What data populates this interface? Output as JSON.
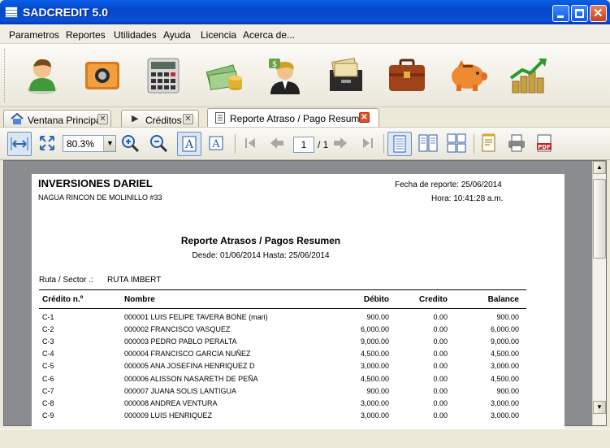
{
  "window": {
    "title": "SADCREDIT 5.0"
  },
  "menu": [
    "Parametros",
    "Reportes",
    "Utilidades",
    "Ayuda",
    "Licencia",
    "Acerca de..."
  ],
  "toolbar_icons": [
    "client-icon",
    "safe-icon",
    "calculator-icon",
    "money-coins-icon",
    "businessman-money-icon",
    "file-cabinet-icon",
    "briefcase-icon",
    "piggy-bank-icon",
    "growth-chart-icon"
  ],
  "tabs": [
    {
      "label": "Ventana Principal",
      "icon": "home-icon"
    },
    {
      "label": "Créditos",
      "icon": "arrow-right-icon"
    },
    {
      "label": "Reporte Atraso / Pago Resumen",
      "icon": "document-icon"
    }
  ],
  "viewer_toolbar": {
    "zoom": "80.3%",
    "page": "1",
    "page_total": "/ 1"
  },
  "report": {
    "company": "INVERSIONES DARIEL",
    "address": "NAGUA RINCON DE MOLINILLO #33",
    "report_date": "Fecha de reporte: 25/06/2014",
    "report_time": "Hora: 10:41:28 a.m.",
    "title": "Reporte Atrasos / Pagos Resumen",
    "range": "Desde: 01/06/2014   Hasta: 25/06/2014",
    "route_label": "Ruta / Sector .:",
    "route_value": "RUTA IMBERT",
    "columns": {
      "credit": "Crédito n.º",
      "name": "Nombre",
      "debit": "Débito",
      "credit_amt": "Credito",
      "balance": "Balance"
    },
    "rows": [
      {
        "credit": "C-1",
        "name": "000001 LUIS FELIPE TAVERA BONE (mari)",
        "debit": "900.00",
        "credit_amt": "0.00",
        "balance": "900.00"
      },
      {
        "credit": "C-2",
        "name": "000002 FRANCISCO VASQUEZ",
        "debit": "6,000.00",
        "credit_amt": "0.00",
        "balance": "6,000.00"
      },
      {
        "credit": "C-3",
        "name": "000003 PEDRO PABLO PERALTA",
        "debit": "9,000.00",
        "credit_amt": "0.00",
        "balance": "9,000.00"
      },
      {
        "credit": "C-4",
        "name": "000004 FRANCISCO GARCIA NUÑEZ",
        "debit": "4,500.00",
        "credit_amt": "0.00",
        "balance": "4,500.00"
      },
      {
        "credit": "C-5",
        "name": "000005 ANA JOSEFINA HENRIQUEZ D",
        "debit": "3,000.00",
        "credit_amt": "0.00",
        "balance": "3,000.00"
      },
      {
        "credit": "C-6",
        "name": "000006 ALISSON NASARETH DE PEÑA",
        "debit": "4,500.00",
        "credit_amt": "0.00",
        "balance": "4,500.00"
      },
      {
        "credit": "C-7",
        "name": "000007 JUANA SOLIS LANTIGUA",
        "debit": "900.00",
        "credit_amt": "0.00",
        "balance": "900.00"
      },
      {
        "credit": "C-8",
        "name": "000008 ANDREA VENTURA",
        "debit": "3,000.00",
        "credit_amt": "0.00",
        "balance": "3,000.00"
      },
      {
        "credit": "C-9",
        "name": "000009 LUIS HENRIQUEZ",
        "debit": "3,000.00",
        "credit_amt": "0.00",
        "balance": "3,000.00"
      }
    ]
  },
  "colors": {
    "titlebar": "#0a5fe6",
    "close_tab": "#e0502c",
    "viewer_bg": "#8a8c90"
  }
}
